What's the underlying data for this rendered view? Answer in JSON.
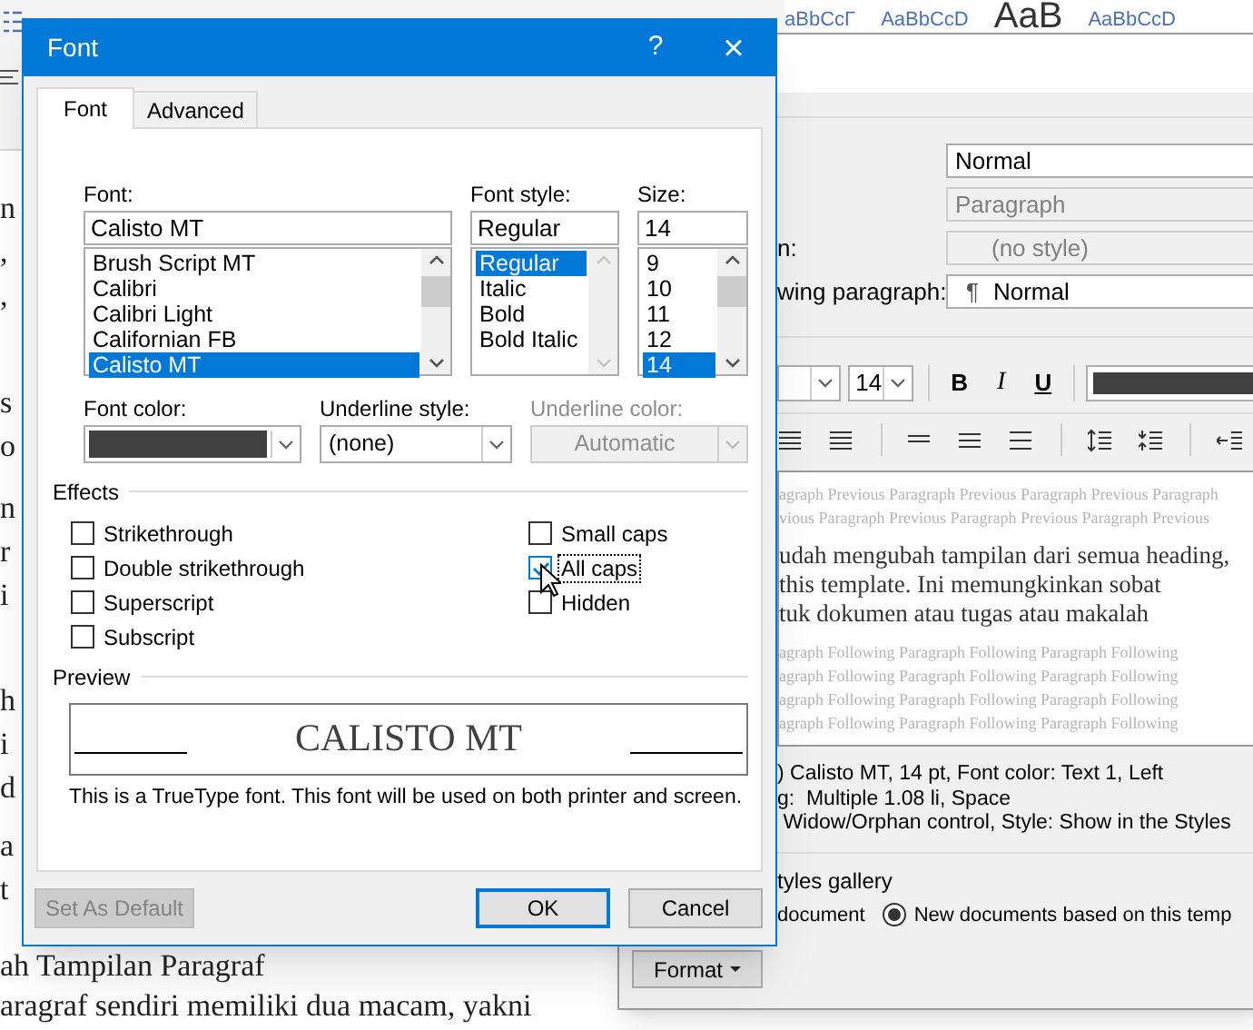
{
  "ribbon": {
    "style_samples": [
      {
        "text": "aBbCcΓ",
        "kind": "small"
      },
      {
        "text": "AaBbCcD",
        "kind": "small"
      },
      {
        "text": "AaB",
        "kind": "large"
      },
      {
        "text": "AaBbCcD",
        "kind": "small"
      }
    ]
  },
  "document": {
    "paragraphs": [
      [
        "n",
        ",",
        ","
      ],
      [
        "s",
        "o"
      ],
      [
        "n",
        "r",
        "i"
      ],
      [
        "h",
        "i",
        "d"
      ],
      [
        "a",
        "t"
      ]
    ],
    "heading": "ah Tampilan Paragraf",
    "last_line": "aragraf sendiri memiliki dua macam, yakni"
  },
  "modify_style": {
    "fields": [
      {
        "value": "Normal",
        "disabled": false
      },
      {
        "value": "Paragraph",
        "disabled": true
      },
      {
        "label": "n:",
        "value": "(no style)",
        "disabled": true
      },
      {
        "label": "wing paragraph:",
        "icon": "¶",
        "value": "Normal",
        "disabled": false
      }
    ],
    "toolbar": {
      "size": "14",
      "bold": "B",
      "italic": "I",
      "underline": "U",
      "color": "#404040"
    },
    "preview": {
      "previous": [
        "agraph Previous Paragraph Previous Paragraph Previous Paragraph",
        "vious Paragraph Previous Paragraph Previous Paragraph Previous"
      ],
      "sample": [
        "udah mengubah tampilan dari semua heading,",
        "this template. Ini memungkinkan sobat",
        "tuk dokumen atau tugas atau makalah"
      ],
      "following": [
        "agraph Following Paragraph Following Paragraph Following",
        "agraph Following Paragraph Following Paragraph Following",
        "agraph Following Paragraph Following Paragraph Following",
        "agraph Following Paragraph Following Paragraph Following"
      ]
    },
    "description": [
      ") Calisto MT, 14 pt, Font color: Text 1, Left",
      "g:  Multiple 1.08 li, Space",
      " Widow/Orphan control, Style: Show in the Styles"
    ],
    "gallery_label": "tyles gallery",
    "options": [
      {
        "label": "document",
        "kind": "cut"
      },
      {
        "label": "New documents based on this temp",
        "kind": "radio",
        "selected": true
      }
    ],
    "format_button": "Format"
  },
  "font_dialog": {
    "title": "Font",
    "help": "?",
    "close": "×",
    "tabs": [
      {
        "label": "Font",
        "selected": true
      },
      {
        "label": "Advanced",
        "selected": false
      }
    ],
    "font": {
      "label": "Font:",
      "value": "Calisto MT",
      "items": [
        {
          "label": "Brush Script MT",
          "selected": false
        },
        {
          "label": "Calibri",
          "selected": false
        },
        {
          "label": "Calibri Light",
          "selected": false
        },
        {
          "label": "Californian FB",
          "selected": false
        },
        {
          "label": "Calisto MT",
          "selected": true
        }
      ]
    },
    "font_style": {
      "label": "Font style:",
      "value": "Regular",
      "items": [
        {
          "label": "Regular",
          "selected": true
        },
        {
          "label": "Italic",
          "selected": false
        },
        {
          "label": "Bold",
          "selected": false
        },
        {
          "label": "Bold Italic",
          "selected": false
        }
      ]
    },
    "size": {
      "label": "Size:",
      "value": "14",
      "items": [
        {
          "label": "9",
          "selected": false
        },
        {
          "label": "10",
          "selected": false
        },
        {
          "label": "11",
          "selected": false
        },
        {
          "label": "12",
          "selected": false
        },
        {
          "label": "14",
          "selected": true
        }
      ]
    },
    "font_color": {
      "label": "Font color:",
      "color": "#404040"
    },
    "underline_style": {
      "label": "Underline style:",
      "value": "(none)",
      "disabled": false
    },
    "underline_color": {
      "label": "Underline color:",
      "value": "Automatic",
      "disabled": true
    },
    "effects": {
      "label": "Effects",
      "left": [
        {
          "label": "Strikethrough",
          "checked": false,
          "focused": false
        },
        {
          "label": "Double strikethrough",
          "checked": false,
          "focused": false
        },
        {
          "label": "Superscript",
          "checked": false,
          "focused": false
        },
        {
          "label": "Subscript",
          "checked": false,
          "focused": false
        }
      ],
      "right": [
        {
          "label": "Small caps",
          "checked": false,
          "focused": false
        },
        {
          "label": "All caps",
          "checked": true,
          "focused": true
        },
        {
          "label": "Hidden",
          "checked": false,
          "focused": false
        }
      ]
    },
    "preview": {
      "label": "Preview",
      "sample": "CALISTO MT",
      "note": "This is a TrueType font. This font will be used on both printer and screen."
    },
    "buttons": [
      {
        "label": "Set As Default",
        "kind": "normal",
        "disabled": true
      },
      {
        "label": "OK",
        "kind": "default",
        "disabled": false
      },
      {
        "label": "Cancel",
        "kind": "normal",
        "disabled": false
      }
    ]
  }
}
